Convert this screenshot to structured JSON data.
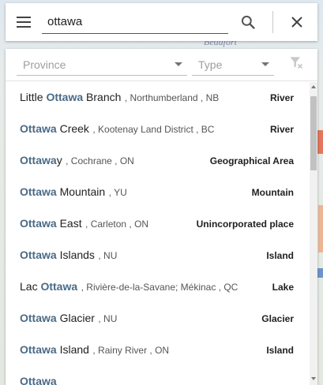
{
  "map": {
    "label": "Beaufort"
  },
  "search": {
    "value": "ottawa",
    "menu_icon": "hamburger-menu-icon",
    "search_icon": "search-icon",
    "close_icon": "close-icon"
  },
  "filters": {
    "province_placeholder": "Province",
    "type_placeholder": "Type",
    "clear_icon": "filter-remove-icon"
  },
  "results": [
    {
      "pre": "Little ",
      "match": "Ottawa",
      "post": " Branch",
      "location": ", Northumberland , NB",
      "type": "River"
    },
    {
      "pre": "",
      "match": "Ottawa",
      "post": " Creek",
      "location": ", Kootenay Land District , BC",
      "type": "River"
    },
    {
      "pre": "",
      "match": "Ottawa",
      "post": "y",
      "location": ", Cochrane , ON",
      "type": "Geographical Area"
    },
    {
      "pre": "",
      "match": "Ottawa",
      "post": " Mountain",
      "location": ", YU",
      "type": "Mountain"
    },
    {
      "pre": "",
      "match": "Ottawa",
      "post": " East",
      "location": ", Carleton , ON",
      "type": "Unincorporated place"
    },
    {
      "pre": "",
      "match": "Ottawa",
      "post": " Islands",
      "location": ", NU",
      "type": "Island"
    },
    {
      "pre": "Lac ",
      "match": "Ottawa",
      "post": "",
      "location": ", Rivière-de-la-Savane; Mékinac , QC",
      "type": "Lake"
    },
    {
      "pre": "",
      "match": "Ottawa",
      "post": " Glacier",
      "location": ", NU",
      "type": "Glacier"
    },
    {
      "pre": "",
      "match": "Ottawa",
      "post": " Island",
      "location": ", Rainy River , ON",
      "type": "Island"
    },
    {
      "pre": "",
      "match": "Ottawa",
      "post": "",
      "location": "",
      "type": ""
    }
  ],
  "scrollbar": {
    "position": 0.0
  }
}
